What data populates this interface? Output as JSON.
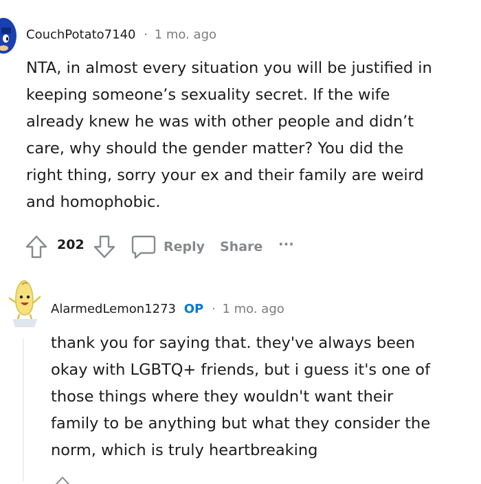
{
  "comment": {
    "username": "CouchPotato7140",
    "separator": "·",
    "time": "1 mo. ago",
    "body_lines": [
      "NTA, in almost every situation you will be justified in",
      "keeping someone’s sexuality secret. If the wife",
      "already knew he was with other people and didn’t",
      "care, why should the gender matter? You did the",
      "right thing, sorry your ex and their family are weird",
      "and homophobic."
    ],
    "score": "202",
    "reply_label": "Reply",
    "share_label": "Share",
    "more_label": "···"
  },
  "reply": {
    "username": "AlarmedLemon1273",
    "op_badge": "OP",
    "separator": "·",
    "time": "1 mo. ago",
    "body_lines": [
      "thank you for saying that. they've always been",
      "okay with LGBTQ+ friends, but i guess it's one of",
      "those things where they wouldn't want their",
      "family to be anything but what they consider the",
      "norm, which is truly heartbreaking"
    ]
  },
  "colors": {
    "text": "#1c1c1c",
    "meta": "#7c7c7c",
    "action": "#878a8c",
    "op": "#0079d3",
    "thread_line": "#edeff1"
  },
  "icons": {
    "comment_avatar": "sonic-avatar-icon",
    "upvote": "upvote-arrow-icon",
    "downvote": "downvote-arrow-icon",
    "reply": "speech-bubble-icon",
    "reply_avatar": "banana-avatar-icon"
  }
}
